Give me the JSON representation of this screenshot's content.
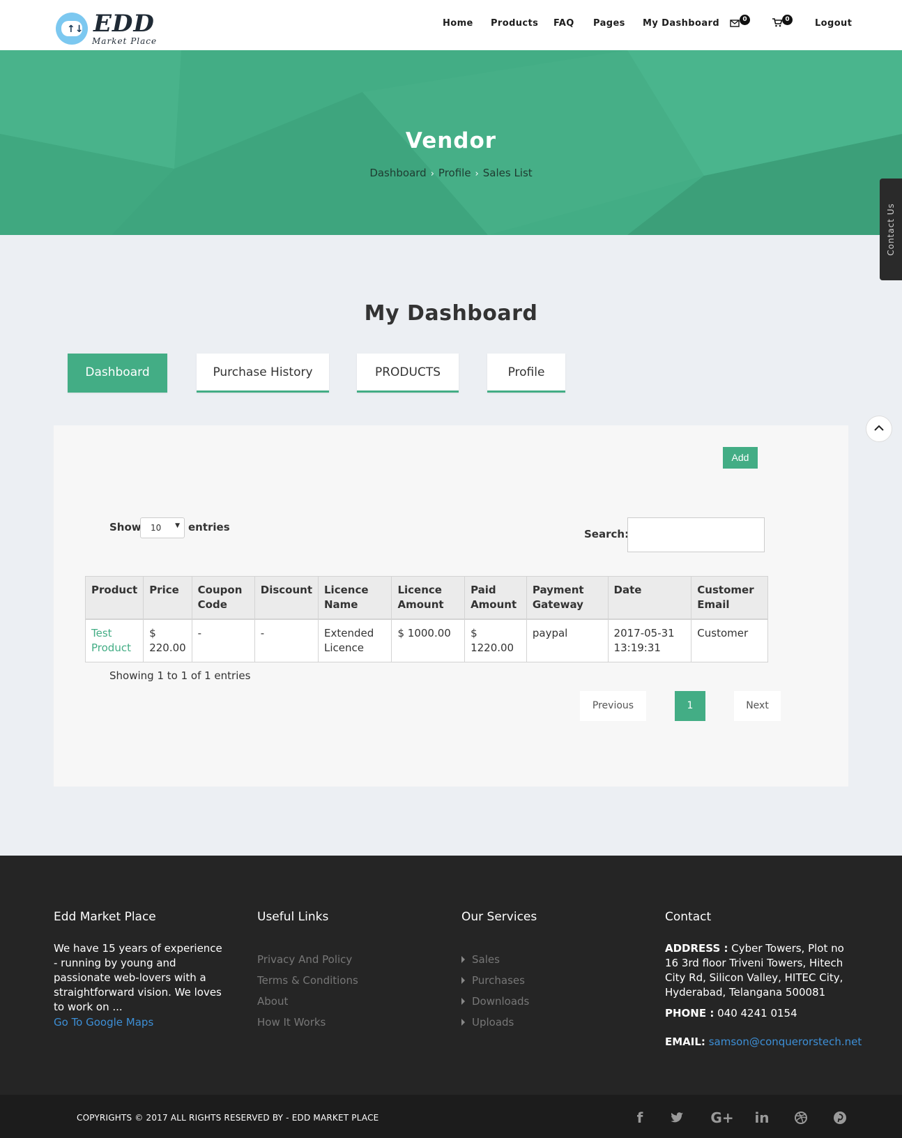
{
  "brand": {
    "title": "EDD",
    "subtitle": "Market Place"
  },
  "nav": {
    "items": [
      "Home",
      "Products",
      "FAQ",
      "Pages",
      "My Dashboard",
      "Logout"
    ],
    "mail_count": "0",
    "cart_count": "0"
  },
  "hero": {
    "title": "Vendor",
    "breadcrumb": [
      "Dashboard",
      "Profile",
      "Sales List"
    ]
  },
  "contact_tab": "Contact Us",
  "section_title": "My Dashboard",
  "tabs": [
    "Dashboard",
    "Purchase History",
    "PRODUCTS",
    "Profile"
  ],
  "panel": {
    "add_label": "Add",
    "show_label": "Show",
    "show_value": "10",
    "entries_label": "entries",
    "search_label": "Search:",
    "search_value": ""
  },
  "table": {
    "headers": [
      "Product",
      "Price",
      "Coupon Code",
      "Discount",
      "Licence Name",
      "Licence Amount",
      "Paid Amount",
      "Payment Gateway",
      "Date",
      "Customer Email"
    ],
    "rows": [
      [
        "Test Product",
        "$ 220.00",
        "-",
        "-",
        "Extended Licence",
        "$ 1000.00",
        "$ 1220.00",
        "paypal",
        "2017-05-31 13:19:31",
        "Customer"
      ]
    ]
  },
  "table_info": "Showing 1 to 1 of 1 entries",
  "pagination": {
    "previous": "Previous",
    "current": "1",
    "next": "Next"
  },
  "footer": {
    "about": {
      "heading": "Edd Market Place",
      "text": "We have 15 years of experience - running by young and passionate web-lovers with a straightforward vision. We loves to work on ...",
      "link": "Go To Google Maps"
    },
    "useful": {
      "heading": "Useful Links",
      "items": [
        "Privacy And Policy",
        "Terms & Conditions",
        "About",
        "How It Works"
      ]
    },
    "services": {
      "heading": "Our Services",
      "items": [
        "Sales",
        "Purchases",
        "Downloads",
        "Uploads"
      ]
    },
    "contact": {
      "heading": "Contact",
      "address_label": "ADDRESS :",
      "address": "Cyber Towers, Plot no 16 3rd floor Triveni Towers, Hitech City Rd, Silicon Valley, HITEC City, Hyderabad, Telangana 500081",
      "phone_label": "PHONE :",
      "phone": "040 4241 0154",
      "email_label": "EMAIL:",
      "email": "samson@conquerorstech.net"
    }
  },
  "copyright": "COPYRIGHTS © 2017 ALL RIGHTS RESERVED BY - EDD MARKET PLACE",
  "social": [
    "facebook-icon",
    "twitter-icon",
    "google-plus-icon",
    "linkedin-icon",
    "dribbble-icon",
    "pinterest-icon"
  ],
  "colors": {
    "accent": "#43ad85",
    "footer": "#252525",
    "link": "#3d8fd6"
  }
}
